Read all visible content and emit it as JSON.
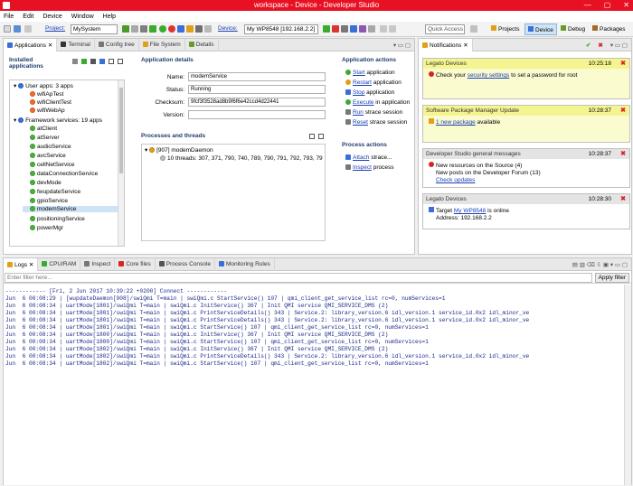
{
  "window": {
    "title": "workspace - Device - Developer Studio",
    "controls": [
      "—",
      "▢",
      "✕"
    ]
  },
  "menu": [
    "File",
    "Edit",
    "Device",
    "Window",
    "Help"
  ],
  "toolbar": {
    "project_label": "Project:",
    "project_value": "MySystem",
    "device_label": "Device:",
    "device_value": "My WP8548 [192.168.2.2]",
    "quick_access": "Quick Access",
    "perspectives": [
      "Projects",
      "Device",
      "Debug",
      "Packages"
    ]
  },
  "left_tabs": [
    "Applications",
    "Terminal",
    "Config tree",
    "File System",
    "Details"
  ],
  "installed_apps": {
    "title": "Installed applications",
    "user_apps_label": "User apps: 3 apps",
    "user_apps": [
      "wifiApTest",
      "wifiClientTest",
      "wifiWebAp"
    ],
    "framework_label": "Framework services: 19 apps",
    "framework_apps": [
      "atClient",
      "atServer",
      "audioService",
      "avcService",
      "cellNetService",
      "dataConnectionService",
      "devMode",
      "fwupdateService",
      "gpioService",
      "modemService",
      "positioningService",
      "powerMgr"
    ],
    "selected": "modemService"
  },
  "app_details": {
    "title": "Application details",
    "name_label": "Name:",
    "name": "modemService",
    "status_label": "Status:",
    "status": "Running",
    "checksum_label": "Checksum:",
    "checksum": "9fcf3f3528ad8b9f6f6e42ccd4d22441",
    "version_label": "Version:",
    "version": ""
  },
  "app_actions": {
    "title": "Application actions",
    "items": [
      {
        "link": "Start",
        "rest": " application",
        "color": "#3bab2e"
      },
      {
        "link": "Restart",
        "rest": " application",
        "color": "#e0a01a"
      },
      {
        "link": "Stop",
        "rest": " application",
        "color": "#3a6ed8"
      },
      {
        "link": "Execute",
        "rest": " in application",
        "color": "#3bab2e"
      },
      {
        "link": "Run",
        "rest": " strace session",
        "color": "#777777"
      },
      {
        "link": "Reset",
        "rest": " strace session",
        "color": "#777777"
      }
    ]
  },
  "processes": {
    "title": "Processes and threads",
    "process": "[907] modemDaemon",
    "threads": "10 threads: 307, 371, 790, 740, 789, 790, 791, 792, 793, 79"
  },
  "process_actions": {
    "title": "Process actions",
    "items": [
      {
        "link": "Attach",
        "rest": " strace..."
      },
      {
        "link": "Inspect",
        "rest": " process"
      }
    ]
  },
  "notifications": {
    "tab": "Notifications",
    "items": [
      {
        "header": "Legato Devices",
        "time": "10:25:18",
        "color": "#f4f490",
        "body_pre": "Check your ",
        "body_link": "security settings",
        "body_post": " to set a password for root"
      },
      {
        "header": "Software Package Manager Update",
        "time": "10:28:37",
        "color": "#f4f490",
        "body_pre": "",
        "body_link": "1 new package",
        "body_post": " available"
      },
      {
        "header": "Developer Studio general messages",
        "time": "10:28:37",
        "color": "#e4e4e4",
        "line1": "New resources on the Source (4)",
        "line2": "New posts on the Developer Forum (13)",
        "link": "Check updates"
      },
      {
        "header": "Legato Devices",
        "time": "10:28:30",
        "color": "#e4e4e4",
        "line1_pre": "Target ",
        "line1_link": "My WP8548",
        "line1_post": " is online",
        "line2": "Address: 192.168.2.2"
      }
    ]
  },
  "bottom_tabs": [
    "Logs",
    "CPU/RAM",
    "Inspect",
    "Core files",
    "Process Console",
    "Monitoring Rules"
  ],
  "logs": {
    "filter_placeholder": "Enter filter here...",
    "apply": "Apply filter",
    "lines": [
      "------------ [Fri, 2 Jun 2017 10:39:22 +0200] Connect ------------",
      "Jun  6 00:08:29 | [wupdateDaemon[908]/swiQmi T=main | swiQmi.c StartService() 107 | qmi_client_get_service_list rc=0, numServices=1",
      "Jun  6 00:08:34 | uartMode[1801]/swiQmi T=main | swiQmi.c InitService() 367 | Init QMI service QMI_SERVICE_DMS (2)",
      "Jun  6 00:08:34 | uartMode[1801]/swiQmi T=main | swiQmi.c PrintServiceDetails() 343 | Service.2: library_version.6 idl_version.1 service_id.0x2 idl_minor_ve",
      "Jun  6 00:08:34 | uartMode[1801]/swiQmi T=main | swiQmi.c PrintServiceDetails() 343 | Service.2: library_version.6 idl_version.1 service_id.0x2 idl_minor_ve",
      "Jun  6 00:08:34 | uartMode[1801]/swiQmi T=main | swiQmi.c StartService() 107 | qmi_client_get_service_list rc=0, numServices=1",
      "Jun  6 00:08:34 | uartMode[1800]/swiQmi T=main | swiQmi.c InitService() 367 | Init QMI service QMI_SERVICE_DMS (2)",
      "Jun  6 00:08:34 | uartMode[1800]/swiQmi T=main | swiQmi.c StartService() 107 | qmi_client_get_service_list rc=0, numServices=1",
      "Jun  6 00:08:34 | uartMode[1802]/swiQmi T=main | swiQmi.c InitService() 367 | Init QMI service QMI_SERVICE_DMS (2)",
      "Jun  6 00:08:34 | uartMode[1802]/swiQmi T=main | swiQmi.c PrintServiceDetails() 343 | Service.2: library_version.6 idl_version.1 service_id.0x2 idl_minor_ve",
      "Jun  6 00:08:34 | uartMode[1802]/swiQmi T=main | swiQmi.c StartService() 107 | qmi_client_get_service_list rc=0, numServices=1"
    ]
  },
  "colors": {
    "titlebar": "#e81123",
    "link": "#1a3fb5",
    "section_title": "#1e3c6e",
    "selection": "#cfe3f7"
  }
}
